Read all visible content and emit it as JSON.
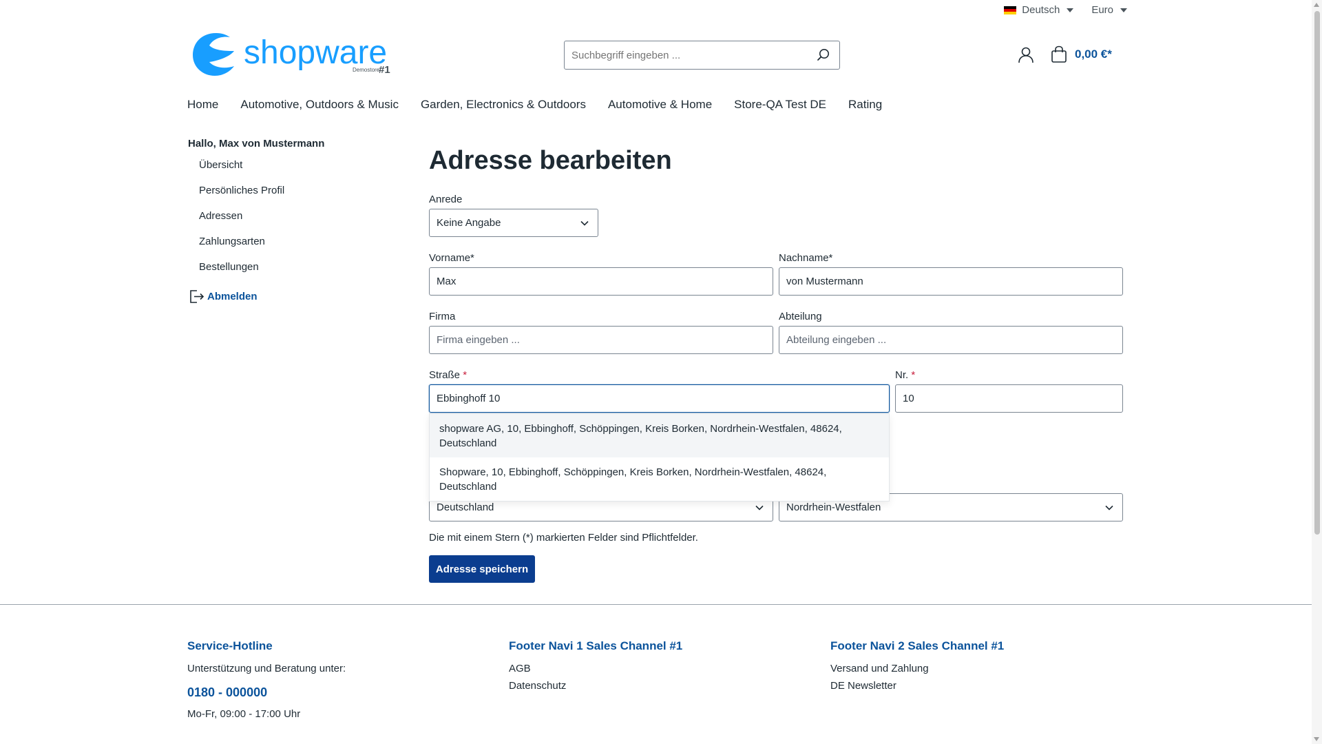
{
  "topbar": {
    "language": "Deutsch",
    "currency": "Euro",
    "flag_colors": [
      "#000000",
      "#dd0000",
      "#ffce00"
    ]
  },
  "header": {
    "logo_text": "shopware",
    "logo_sub": "Demostore",
    "logo_num": "#1",
    "search_placeholder": "Suchbegriff eingeben ...",
    "cart_total": "0,00 €*"
  },
  "nav": {
    "items": [
      {
        "label": "Home"
      },
      {
        "label": "Automotive, Outdoors & Music"
      },
      {
        "label": "Garden, Electronics & Outdoors"
      },
      {
        "label": "Automotive & Home"
      },
      {
        "label": "Store-QA Test DE"
      },
      {
        "label": "Rating"
      }
    ]
  },
  "sidebar": {
    "greeting": "Hallo, Max von Mustermann",
    "items": [
      {
        "label": "Übersicht"
      },
      {
        "label": "Persönliches Profil"
      },
      {
        "label": "Adressen"
      },
      {
        "label": "Zahlungsarten"
      },
      {
        "label": "Bestellungen"
      }
    ],
    "logout": "Abmelden"
  },
  "form": {
    "title": "Adresse bearbeiten",
    "salutation_label": "Anrede",
    "salutation_value": "Keine Angabe",
    "firstname_label": "Vorname*",
    "firstname_value": "Max",
    "lastname_label": "Nachname*",
    "lastname_value": "von Mustermann",
    "company_label": "Firma",
    "company_placeholder": "Firma eingeben ...",
    "department_label": "Abteilung",
    "department_placeholder": "Abteilung eingeben ...",
    "street_label": "Straße",
    "street_value": "Ebbinghoff 10",
    "number_label": "Nr.",
    "number_value": "10",
    "required_mark": "*",
    "country_value": "Deutschland",
    "state_value": "Nordrhein-Westfalen",
    "suggestions": [
      {
        "line1": "shopware AG, 10, Ebbinghoff, Schöppingen, Kreis Borken, Nordrhein-Westfalen, 48624,",
        "line2": "Deutschland"
      },
      {
        "line1": "Shopware, 10, Ebbinghoff, Schöppingen, Kreis Borken, Nordrhein-Westfalen, 48624,",
        "line2": "Deutschland"
      }
    ],
    "hint": "Die mit einem Stern (*) markierten Felder sind Pflichtfelder.",
    "save_label": "Adresse speichern"
  },
  "footer": {
    "col1": {
      "title": "Service-Hotline",
      "text": "Unterstützung und Beratung unter:",
      "phone": "0180 - 000000",
      "hours": "Mo-Fr, 09:00 - 17:00 Uhr"
    },
    "col2": {
      "title": "Footer Navi 1 Sales Channel #1",
      "links": [
        {
          "label": "AGB"
        },
        {
          "label": "Datenschutz"
        }
      ]
    },
    "col3": {
      "title": "Footer Navi 2 Sales Channel #1",
      "links": [
        {
          "label": "Versand und Zahlung"
        },
        {
          "label": "DE Newsletter"
        }
      ]
    }
  },
  "colors": {
    "brand": "#189eff",
    "primary": "#0b539b",
    "button": "#0b3d8f",
    "required": "#c81e3c"
  }
}
